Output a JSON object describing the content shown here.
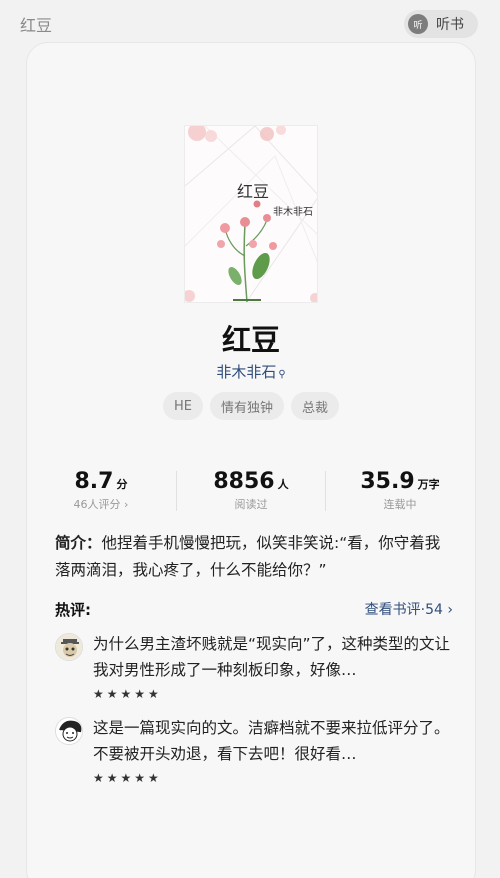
{
  "header": {
    "title": "红豆",
    "listen_icon_text": "听",
    "listen_label": "听书"
  },
  "book": {
    "cover_title": "红豆",
    "cover_author": "非木非石",
    "title": "红豆",
    "author": "非木非石",
    "author_search_icon": "search-icon",
    "tags": [
      "HE",
      "情有独钟",
      "总裁"
    ]
  },
  "stats": {
    "score": "8.7",
    "score_unit": "分",
    "score_sub": "46人评分 ›",
    "reads": "8856",
    "reads_unit": "人",
    "reads_sub": "阅读过",
    "words": "35.9",
    "words_unit": "万字",
    "words_sub": "连载中"
  },
  "intro": {
    "label": "简介：",
    "text": "他捏着手机慢慢把玩，似笑非笑说:“看，你守着我落两滴泪，我心疼了，什么不能给你？”"
  },
  "reviews": {
    "label": "热评:",
    "more_label": "查看书评·54 ›",
    "items": [
      {
        "text": "为什么男主渣坏贱就是“现实向”了，这种类型的文让我对男性形成了一种刻板印象，好像…",
        "stars": "★★★★★"
      },
      {
        "text": "这是一篇现实向的文。洁癖档就不要来拉低评分了。不要被开头劝退，看下去吧！很好看…",
        "stars": "★★★★★"
      }
    ]
  },
  "colors": {
    "link": "#2f4e7c",
    "background": "#f2f2f2",
    "card": "#f7f7f7"
  }
}
